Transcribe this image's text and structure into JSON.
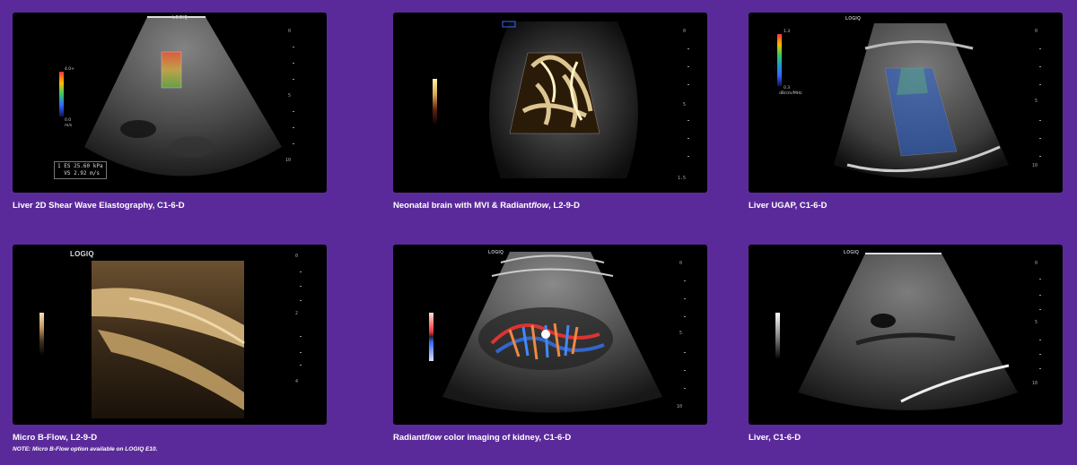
{
  "panels": [
    {
      "caption_pre": "Liver 2D Shear Wave Elastography, C1-6-D",
      "caption_italic": "",
      "caption_post": "",
      "brand": "LOGIQ",
      "scale": [
        "0",
        "5",
        "10"
      ],
      "colorbar": {
        "top": "4.0+",
        "bottom": "0.0",
        "unit": "m/s"
      },
      "measurement": {
        "index": "1",
        "row1": "ES  25.60 kPa",
        "row2": "VS   2.92 m/s"
      }
    },
    {
      "caption_pre": "Neonatal brain with MVI & Radiant",
      "caption_italic": "flow",
      "caption_post": ", L2-9-D",
      "brand": "",
      "scale": [
        "0",
        "5",
        "1.5"
      ]
    },
    {
      "caption_pre": "Liver UGAP, C1-6-D",
      "caption_italic": "",
      "caption_post": "",
      "brand": "LOGIQ",
      "scale": [
        "0",
        "5",
        "10"
      ],
      "colorbar": {
        "top": "1.3",
        "bottom": "0.3",
        "unit": "dB/cm/MHz"
      }
    },
    {
      "caption_pre": "Micro B-Flow, L2-9-D",
      "caption_italic": "",
      "caption_post": "",
      "brand": "LOGIQ",
      "scale": [
        "0",
        "2",
        "4"
      ]
    },
    {
      "caption_pre": "Radiant",
      "caption_italic": "flow",
      "caption_post": " color imaging of kidney, C1-6-D",
      "brand": "LOGIQ",
      "scale": [
        "0",
        "5",
        "10"
      ]
    },
    {
      "caption_pre": "Liver, C1-6-D",
      "caption_italic": "",
      "caption_post": "",
      "brand": "LOGIQ",
      "scale": [
        "0",
        "5",
        "10"
      ]
    }
  ],
  "note": "NOTE: Micro B-Flow option available on LOGIQ E10.",
  "colors": {
    "background": "#5b2a9a",
    "panel": "#000000",
    "caption": "#ffffff"
  }
}
